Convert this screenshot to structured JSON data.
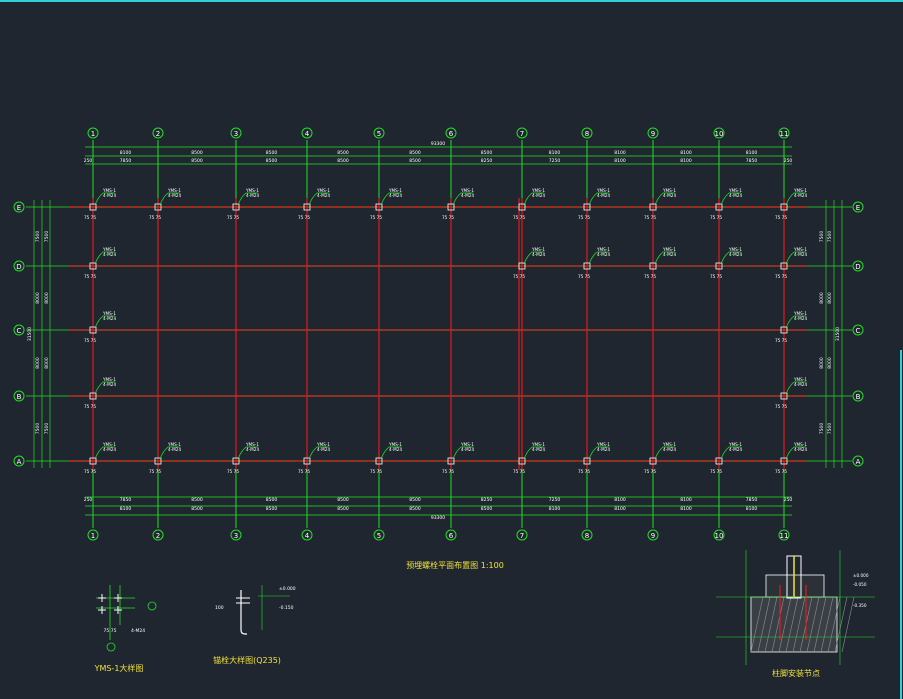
{
  "drawing": {
    "main_title": "预埋螺栓平面布置图 1:100",
    "detail_titles": {
      "bolt_detail": "YMS-1大样图",
      "anchor_detail": "锚栓大样图(Q235)",
      "column_node": "柱脚安装节点"
    },
    "bolt_tag": "YMS-1",
    "bolt_spec": "4-M24",
    "spacing_label": "75 75",
    "colors": {
      "background": "#1f2630",
      "axis": "#22e022",
      "beam": "#e21b1b",
      "dimension": "#22e022",
      "text": "#ffffff",
      "accent": "#f2e23a",
      "frame": "#2fd0d8"
    }
  },
  "grid": {
    "columns": [
      "1",
      "2",
      "3",
      "4",
      "5",
      "6",
      "7",
      "8",
      "9",
      "10",
      "11"
    ],
    "rows": [
      "E",
      "D",
      "C",
      "B",
      "A"
    ],
    "top_total": "93300",
    "bottom_total": "93300",
    "top_dims": [
      "8100",
      "8500",
      "8500",
      "8500",
      "8500",
      "8500",
      "8100",
      "8100",
      "8100",
      "8100"
    ],
    "top_sub_dims": [
      "7850",
      "8500",
      "8500",
      "8500",
      "8500",
      "8250",
      "7250",
      "8100",
      "8100",
      "7850"
    ],
    "bottom_dims": [
      "7850",
      "8500",
      "8500",
      "8500",
      "8500",
      "8250",
      "7250",
      "8100",
      "8100",
      "7850"
    ],
    "bottom_sub_dims": [
      "8100",
      "8500",
      "8500",
      "8500",
      "8500",
      "8500",
      "8100",
      "8100",
      "8100",
      "8100"
    ],
    "left_total": "31500",
    "left_dims": [
      "7500",
      "8000",
      "8000",
      "7500"
    ],
    "right_total": "31500",
    "right_dims": [
      "7500",
      "8000",
      "8000",
      "7500"
    ],
    "edge_dim": "250"
  },
  "node_labels": {
    "elev1": "±0.000",
    "elev2": "-0.050",
    "elev3": "-0.150",
    "elev4": "-0.350",
    "anchor_len": "100"
  }
}
